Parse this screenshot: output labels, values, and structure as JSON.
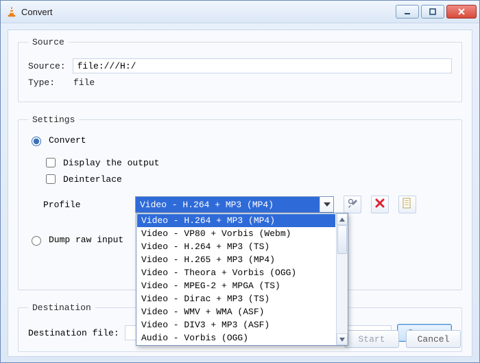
{
  "window": {
    "title": "Convert"
  },
  "source_group": {
    "legend": "Source",
    "source_label": "Source:",
    "source_value": "file:///H:/",
    "type_label": "Type:",
    "type_value": "file"
  },
  "settings_group": {
    "legend": "Settings",
    "convert_label": "Convert",
    "display_output_label": "Display the output",
    "deinterlace_label": "Deinterlace",
    "profile_label": "Profile",
    "profile_selected": "Video - H.264 + MP3 (MP4)",
    "profile_options": [
      "Video - H.264 + MP3 (MP4)",
      "Video - VP80 + Vorbis (Webm)",
      "Video - H.264 + MP3 (TS)",
      "Video - H.265 + MP3 (MP4)",
      "Video - Theora + Vorbis (OGG)",
      "Video - MPEG-2 + MPGA (TS)",
      "Video - Dirac + MP3 (TS)",
      "Video - WMV + WMA (ASF)",
      "Video - DIV3 + MP3 (ASF)",
      "Audio - Vorbis (OGG)"
    ],
    "dump_label": "Dump raw input"
  },
  "destination_group": {
    "legend": "Destination",
    "file_label": "Destination file:",
    "file_value": "",
    "browse_label": "Browse"
  },
  "buttons": {
    "start": "Start",
    "cancel": "Cancel"
  },
  "icons": {
    "edit": "edit-profile-icon",
    "delete": "delete-profile-icon",
    "new": "new-profile-icon"
  }
}
